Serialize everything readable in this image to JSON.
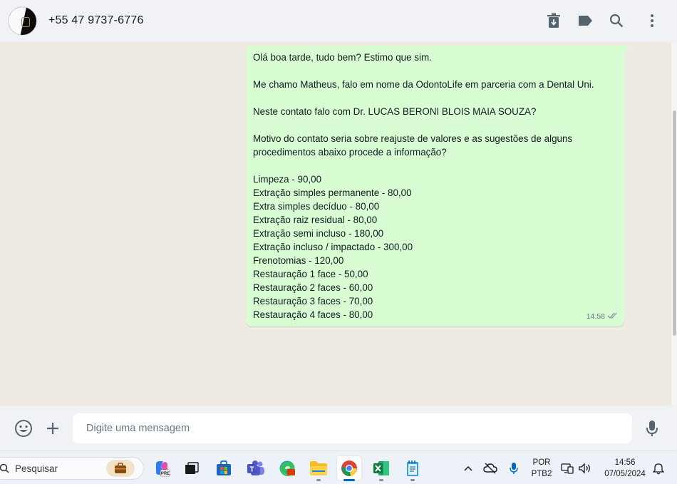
{
  "header": {
    "contact_name": "+55 47 9737-6776",
    "icons": [
      "archive-icon",
      "label-icon",
      "search-icon",
      "menu-icon"
    ]
  },
  "message": {
    "lines": [
      "Olá boa tarde, tudo bem? Estimo que sim.",
      "",
      "Me chamo Matheus, falo em nome da OdontoLife em parceria com a Dental Uni.",
      "",
      "Neste contato falo com Dr. LUCAS BERONI BLOIS MAIA SOUZA?",
      "",
      "Motivo do contato seria sobre reajuste de valores e as sugestões de alguns",
      "procedimentos abaixo procede a informação?",
      "",
      "Limpeza - 90,00",
      "Extração simples permanente - 80,00",
      "Extra simples decíduo - 80,00",
      "Extração raiz residual - 80,00",
      "Extração semi incluso - 180,00",
      "Extração incluso / impactado - 300,00",
      "Frenotomias - 120,00",
      "Restauração 1 face - 50,00",
      "Restauração 2 faces - 60,00",
      "Restauração 3 faces - 70,00",
      "Restauração 4 faces - 80,00"
    ],
    "time": "14:58",
    "status_icon": "double-check-icon"
  },
  "composer": {
    "placeholder": "Digite uma mensagem",
    "icons": [
      "emoji-icon",
      "plus-icon",
      "microphone-icon"
    ]
  },
  "taskbar": {
    "search_placeholder": "Pesquisar",
    "apps": [
      "copilot",
      "task-view",
      "microsoft-store",
      "teams",
      "edge",
      "file-explorer",
      "chrome",
      "excel",
      "notepad"
    ],
    "active_app": "chrome",
    "language_line1": "POR",
    "language_line2": "PTB2",
    "clock_time": "14:56",
    "clock_date": "07/05/2024",
    "colors": {
      "accent": "#0067c0",
      "bubble": "#d9fdd3",
      "chat_bg": "#efeae2"
    }
  }
}
